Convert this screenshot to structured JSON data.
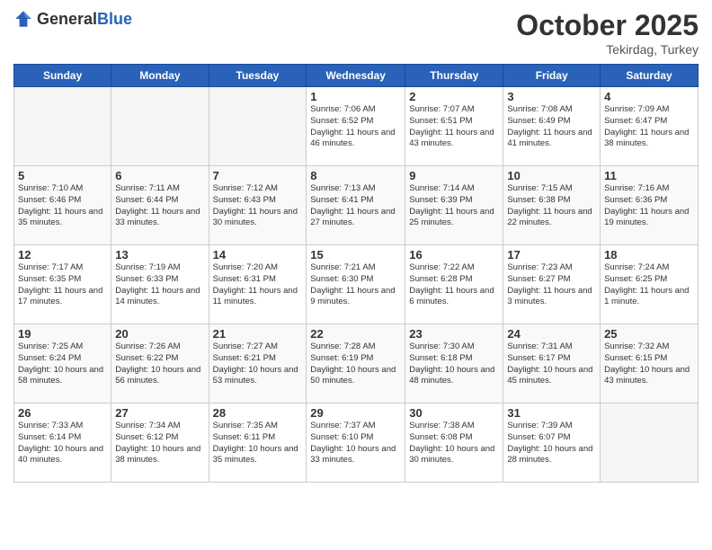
{
  "header": {
    "logo_general": "General",
    "logo_blue": "Blue",
    "month": "October 2025",
    "location": "Tekirdag, Turkey"
  },
  "weekdays": [
    "Sunday",
    "Monday",
    "Tuesday",
    "Wednesday",
    "Thursday",
    "Friday",
    "Saturday"
  ],
  "rows": [
    [
      {
        "day": "",
        "info": ""
      },
      {
        "day": "",
        "info": ""
      },
      {
        "day": "",
        "info": ""
      },
      {
        "day": "1",
        "info": "Sunrise: 7:06 AM\nSunset: 6:52 PM\nDaylight: 11 hours and 46 minutes."
      },
      {
        "day": "2",
        "info": "Sunrise: 7:07 AM\nSunset: 6:51 PM\nDaylight: 11 hours and 43 minutes."
      },
      {
        "day": "3",
        "info": "Sunrise: 7:08 AM\nSunset: 6:49 PM\nDaylight: 11 hours and 41 minutes."
      },
      {
        "day": "4",
        "info": "Sunrise: 7:09 AM\nSunset: 6:47 PM\nDaylight: 11 hours and 38 minutes."
      }
    ],
    [
      {
        "day": "5",
        "info": "Sunrise: 7:10 AM\nSunset: 6:46 PM\nDaylight: 11 hours and 35 minutes."
      },
      {
        "day": "6",
        "info": "Sunrise: 7:11 AM\nSunset: 6:44 PM\nDaylight: 11 hours and 33 minutes."
      },
      {
        "day": "7",
        "info": "Sunrise: 7:12 AM\nSunset: 6:43 PM\nDaylight: 11 hours and 30 minutes."
      },
      {
        "day": "8",
        "info": "Sunrise: 7:13 AM\nSunset: 6:41 PM\nDaylight: 11 hours and 27 minutes."
      },
      {
        "day": "9",
        "info": "Sunrise: 7:14 AM\nSunset: 6:39 PM\nDaylight: 11 hours and 25 minutes."
      },
      {
        "day": "10",
        "info": "Sunrise: 7:15 AM\nSunset: 6:38 PM\nDaylight: 11 hours and 22 minutes."
      },
      {
        "day": "11",
        "info": "Sunrise: 7:16 AM\nSunset: 6:36 PM\nDaylight: 11 hours and 19 minutes."
      }
    ],
    [
      {
        "day": "12",
        "info": "Sunrise: 7:17 AM\nSunset: 6:35 PM\nDaylight: 11 hours and 17 minutes."
      },
      {
        "day": "13",
        "info": "Sunrise: 7:19 AM\nSunset: 6:33 PM\nDaylight: 11 hours and 14 minutes."
      },
      {
        "day": "14",
        "info": "Sunrise: 7:20 AM\nSunset: 6:31 PM\nDaylight: 11 hours and 11 minutes."
      },
      {
        "day": "15",
        "info": "Sunrise: 7:21 AM\nSunset: 6:30 PM\nDaylight: 11 hours and 9 minutes."
      },
      {
        "day": "16",
        "info": "Sunrise: 7:22 AM\nSunset: 6:28 PM\nDaylight: 11 hours and 6 minutes."
      },
      {
        "day": "17",
        "info": "Sunrise: 7:23 AM\nSunset: 6:27 PM\nDaylight: 11 hours and 3 minutes."
      },
      {
        "day": "18",
        "info": "Sunrise: 7:24 AM\nSunset: 6:25 PM\nDaylight: 11 hours and 1 minute."
      }
    ],
    [
      {
        "day": "19",
        "info": "Sunrise: 7:25 AM\nSunset: 6:24 PM\nDaylight: 10 hours and 58 minutes."
      },
      {
        "day": "20",
        "info": "Sunrise: 7:26 AM\nSunset: 6:22 PM\nDaylight: 10 hours and 56 minutes."
      },
      {
        "day": "21",
        "info": "Sunrise: 7:27 AM\nSunset: 6:21 PM\nDaylight: 10 hours and 53 minutes."
      },
      {
        "day": "22",
        "info": "Sunrise: 7:28 AM\nSunset: 6:19 PM\nDaylight: 10 hours and 50 minutes."
      },
      {
        "day": "23",
        "info": "Sunrise: 7:30 AM\nSunset: 6:18 PM\nDaylight: 10 hours and 48 minutes."
      },
      {
        "day": "24",
        "info": "Sunrise: 7:31 AM\nSunset: 6:17 PM\nDaylight: 10 hours and 45 minutes."
      },
      {
        "day": "25",
        "info": "Sunrise: 7:32 AM\nSunset: 6:15 PM\nDaylight: 10 hours and 43 minutes."
      }
    ],
    [
      {
        "day": "26",
        "info": "Sunrise: 7:33 AM\nSunset: 6:14 PM\nDaylight: 10 hours and 40 minutes."
      },
      {
        "day": "27",
        "info": "Sunrise: 7:34 AM\nSunset: 6:12 PM\nDaylight: 10 hours and 38 minutes."
      },
      {
        "day": "28",
        "info": "Sunrise: 7:35 AM\nSunset: 6:11 PM\nDaylight: 10 hours and 35 minutes."
      },
      {
        "day": "29",
        "info": "Sunrise: 7:37 AM\nSunset: 6:10 PM\nDaylight: 10 hours and 33 minutes."
      },
      {
        "day": "30",
        "info": "Sunrise: 7:38 AM\nSunset: 6:08 PM\nDaylight: 10 hours and 30 minutes."
      },
      {
        "day": "31",
        "info": "Sunrise: 7:39 AM\nSunset: 6:07 PM\nDaylight: 10 hours and 28 minutes."
      },
      {
        "day": "",
        "info": ""
      }
    ]
  ]
}
